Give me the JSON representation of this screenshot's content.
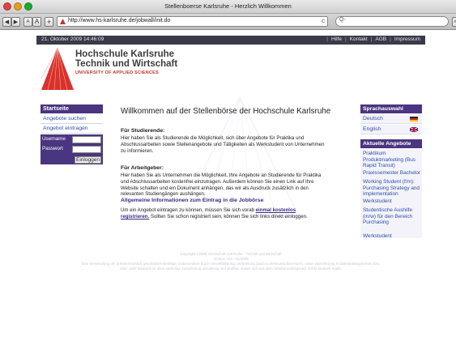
{
  "browser": {
    "window_title": "Stellenboerse Karlsruhe - Herzlich Willkommen",
    "url": "http://www.hs-karlsruhe.de/jobwall/init.do",
    "search_placeholder": "Q-",
    "buttons": {
      "back": "◀",
      "forward": "▶",
      "smaller": "A",
      "larger": "A",
      "add": "+"
    },
    "reload": "c",
    "edge": "⌕"
  },
  "site": {
    "topbar": {
      "date": "21. Oktober 2009 14:46:09",
      "nav": [
        "Hilfe",
        "Kontakt",
        "AGB",
        "Impressum"
      ],
      "separator": "|"
    },
    "logo": {
      "line1": "Hochschule Karlsruhe",
      "line2": "Technik und Wirtschaft",
      "line3": "UNIVERSITY OF APPLIED SCIENCES"
    },
    "left_nav": {
      "header": "Startseite",
      "items": [
        "Angebote suchen",
        "Angebot eintragen"
      ],
      "login": {
        "username_label": "Username",
        "password_label": "Passwort",
        "button": "Einloggen"
      }
    },
    "main": {
      "title": "Willkommen auf der Stellenbörse der Hochschule Karlsruhe",
      "students_heading": "Für Studierende:",
      "students_text": "Hier haben Sie als Studierende die Möglichkeit, sich über Angebote für Praktika und Abschlussarbeiten sowie Stellenangebote und Tätigkeiten als Werkstudent von Unternehmen zu informieren.",
      "employers_heading": "Für Arbeitgeber:",
      "employers_text": "Hier haben Sie als Unternehmen die Möglichkeit, Ihre Angebote an Studierende für Praktika und Abschlussarbeiten kostenfrei einzutragen. Außerdem können Sie einen Link auf Ihre Website schalten und ein Dokument anhängen, das wir als Ausdruck zusätzlich in den relevanten Studiengängen aushängen.",
      "info_link": "Allgemeine Informationen zum Eintrag in die Jobbörse",
      "register_prefix": "Um ein Angebot eintragen zu können, müssen Sie sich vorab ",
      "register_link": "einmal kostenlos registrieren.",
      "register_suffix": " Sollten Sie schon registriert sein, können Sie sich links direkt einloggen."
    },
    "right": {
      "lang_header": "Sprachauswahl",
      "languages": [
        "Deutsch",
        "English"
      ],
      "offers_header": "Aktuelle Angebote",
      "offers": [
        "Praktikum Produktmarketing (Bus Rapid Transit)",
        "Praxissemester Bachelor",
        "Working Student (f/m): Purchasing Strategy and Implementation",
        "Werkstudent",
        "Studentische Aushilfe (m/w) für den Bereich Purchasing",
        "Werkstudent"
      ]
    },
    "footer": {
      "line1": "Copyright ©2005 Hochschule Karlsruhe - Technik und Wirtschaft",
      "line2": "Version 723 • 02/2009",
      "line3": "Eine Verwendung der urheberrechtlich geschützten Beiträge, insbesondere durch Vervielfältigung, Verbreitung (auch in elektronischen Form), sowie Speicherung in Datenbanksystemen bzw.",
      "line4": "Inter- oder Intranets ist ohne vorherige Zustimmung unzulässig und strafbar, soweit sich aus dem Urheberrechtsgesetz nichts anderes ergibt."
    }
  },
  "colors": {
    "accent": "#4a3580",
    "topbar": "#3a3a4a",
    "logo_red": "#c0392b",
    "link": "#2c4fa8"
  }
}
